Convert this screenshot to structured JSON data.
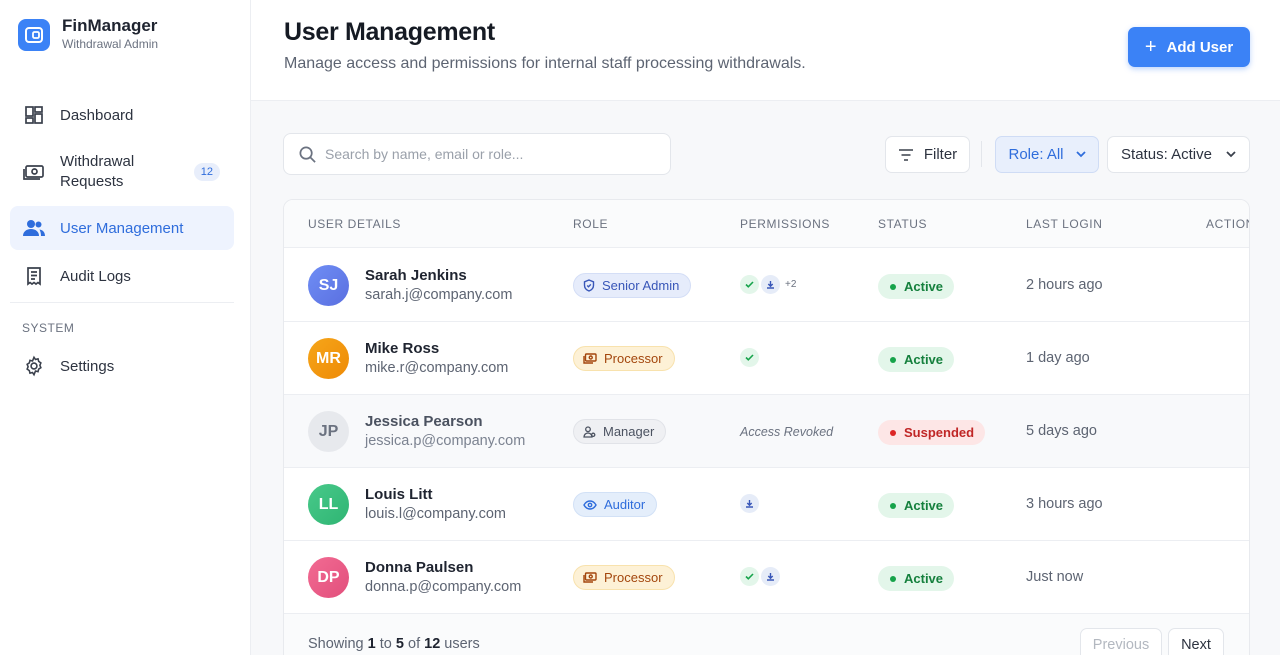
{
  "brand": {
    "name": "FinManager",
    "subtitle": "Withdrawal Admin"
  },
  "sidebar": {
    "items": [
      {
        "label": "Dashboard",
        "icon": "dashboard-icon"
      },
      {
        "label": "Withdrawal Requests",
        "icon": "money-icon",
        "badge": "12"
      },
      {
        "label": "User Management",
        "icon": "users-icon",
        "active": true
      },
      {
        "label": "Audit Logs",
        "icon": "receipt-icon"
      }
    ],
    "section_label": "SYSTEM",
    "system_items": [
      {
        "label": "Settings",
        "icon": "gear-icon"
      }
    ]
  },
  "header": {
    "title": "User Management",
    "subtitle": "Manage access and permissions for internal staff processing withdrawals.",
    "add_button": "Add User"
  },
  "toolbar": {
    "search_placeholder": "Search by name, email or role...",
    "filter_label": "Filter",
    "role_filter": "Role: All",
    "status_filter": "Status: Active"
  },
  "table": {
    "columns": [
      "USER DETAILS",
      "ROLE",
      "PERMISSIONS",
      "STATUS",
      "LAST LOGIN",
      "ACTIONS"
    ],
    "rows": [
      {
        "initials": "SJ",
        "name": "Sarah Jenkins",
        "email": "sarah.j@company.com",
        "role": "Senior Admin",
        "permissions": "+2",
        "status": "Active",
        "last_login": "2 hours ago"
      },
      {
        "initials": "MR",
        "name": "Mike Ross",
        "email": "mike.r@company.com",
        "role": "Processor",
        "status": "Active",
        "last_login": "1 day ago"
      },
      {
        "initials": "JP",
        "name": "Jessica Pearson",
        "email": "jessica.p@company.com",
        "role": "Manager",
        "permissions": "Access Revoked",
        "status": "Suspended",
        "last_login": "5 days ago"
      },
      {
        "initials": "LL",
        "name": "Louis Litt",
        "email": "louis.l@company.com",
        "role": "Auditor",
        "status": "Active",
        "last_login": "3 hours ago"
      },
      {
        "initials": "DP",
        "name": "Donna Paulsen",
        "email": "donna.p@company.com",
        "role": "Processor",
        "status": "Active",
        "last_login": "Just now"
      }
    ]
  },
  "pagination": {
    "showing_prefix": "Showing",
    "from": "1",
    "to_word": "to",
    "to": "5",
    "of_word": "of",
    "total": "12",
    "suffix": "users",
    "previous": "Previous",
    "next": "Next"
  },
  "colors": {
    "accent": "#3b82f6",
    "active": "#16a34a",
    "suspended": "#dc2626"
  }
}
